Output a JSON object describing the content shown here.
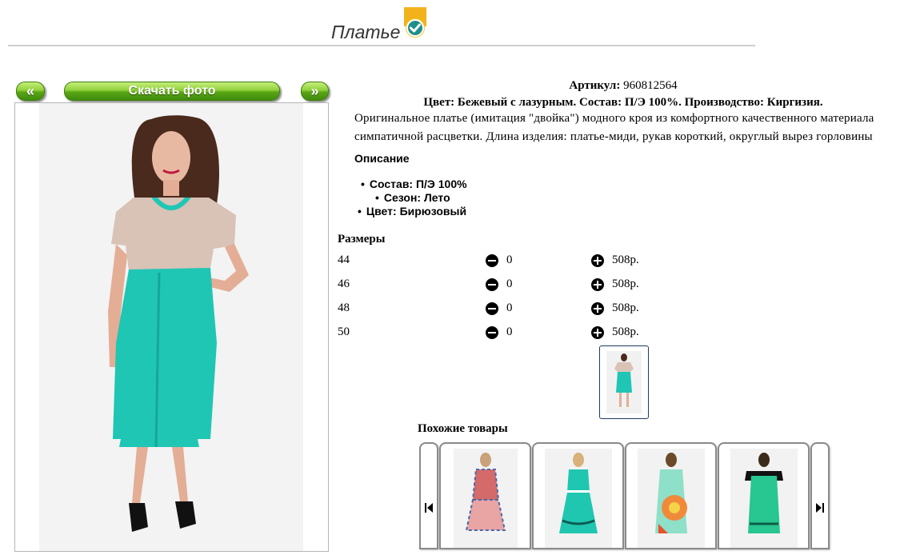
{
  "header": {
    "title": "Платье"
  },
  "gallery": {
    "prev_label": "«",
    "download_label": "Скачать фото",
    "next_label": "»"
  },
  "product": {
    "article_label": "Артикул:",
    "article_value": "960812564",
    "summary": "Цвет: Бежевый с лазурным. Состав: П/Э 100%. Производство: Киргизия.",
    "description_line1": "Оригинальное платье (имитация \"двойка\") модного кроя из комфортного качественного материала",
    "description_line2": "симпатичной расцветки. Длина изделия: платье-миди, рукав короткий, округлый вырез горловины",
    "description_heading": "Описание",
    "attributes": [
      "Состав: П/Э 100%",
      "Сезон: Лето",
      "Цвет: Бирюзовый"
    ]
  },
  "sizes": {
    "heading": "Размеры",
    "rows": [
      {
        "size": "44",
        "qty": "0",
        "price": "508р."
      },
      {
        "size": "46",
        "qty": "0",
        "price": "508р."
      },
      {
        "size": "48",
        "qty": "0",
        "price": "508р."
      },
      {
        "size": "50",
        "qty": "0",
        "price": "508р."
      }
    ]
  },
  "similar": {
    "heading": "Похожие товары"
  },
  "colors": {
    "turquoise": "#1fc6b4",
    "beige": "#d9c2b6",
    "button_green": "#5aa515"
  }
}
